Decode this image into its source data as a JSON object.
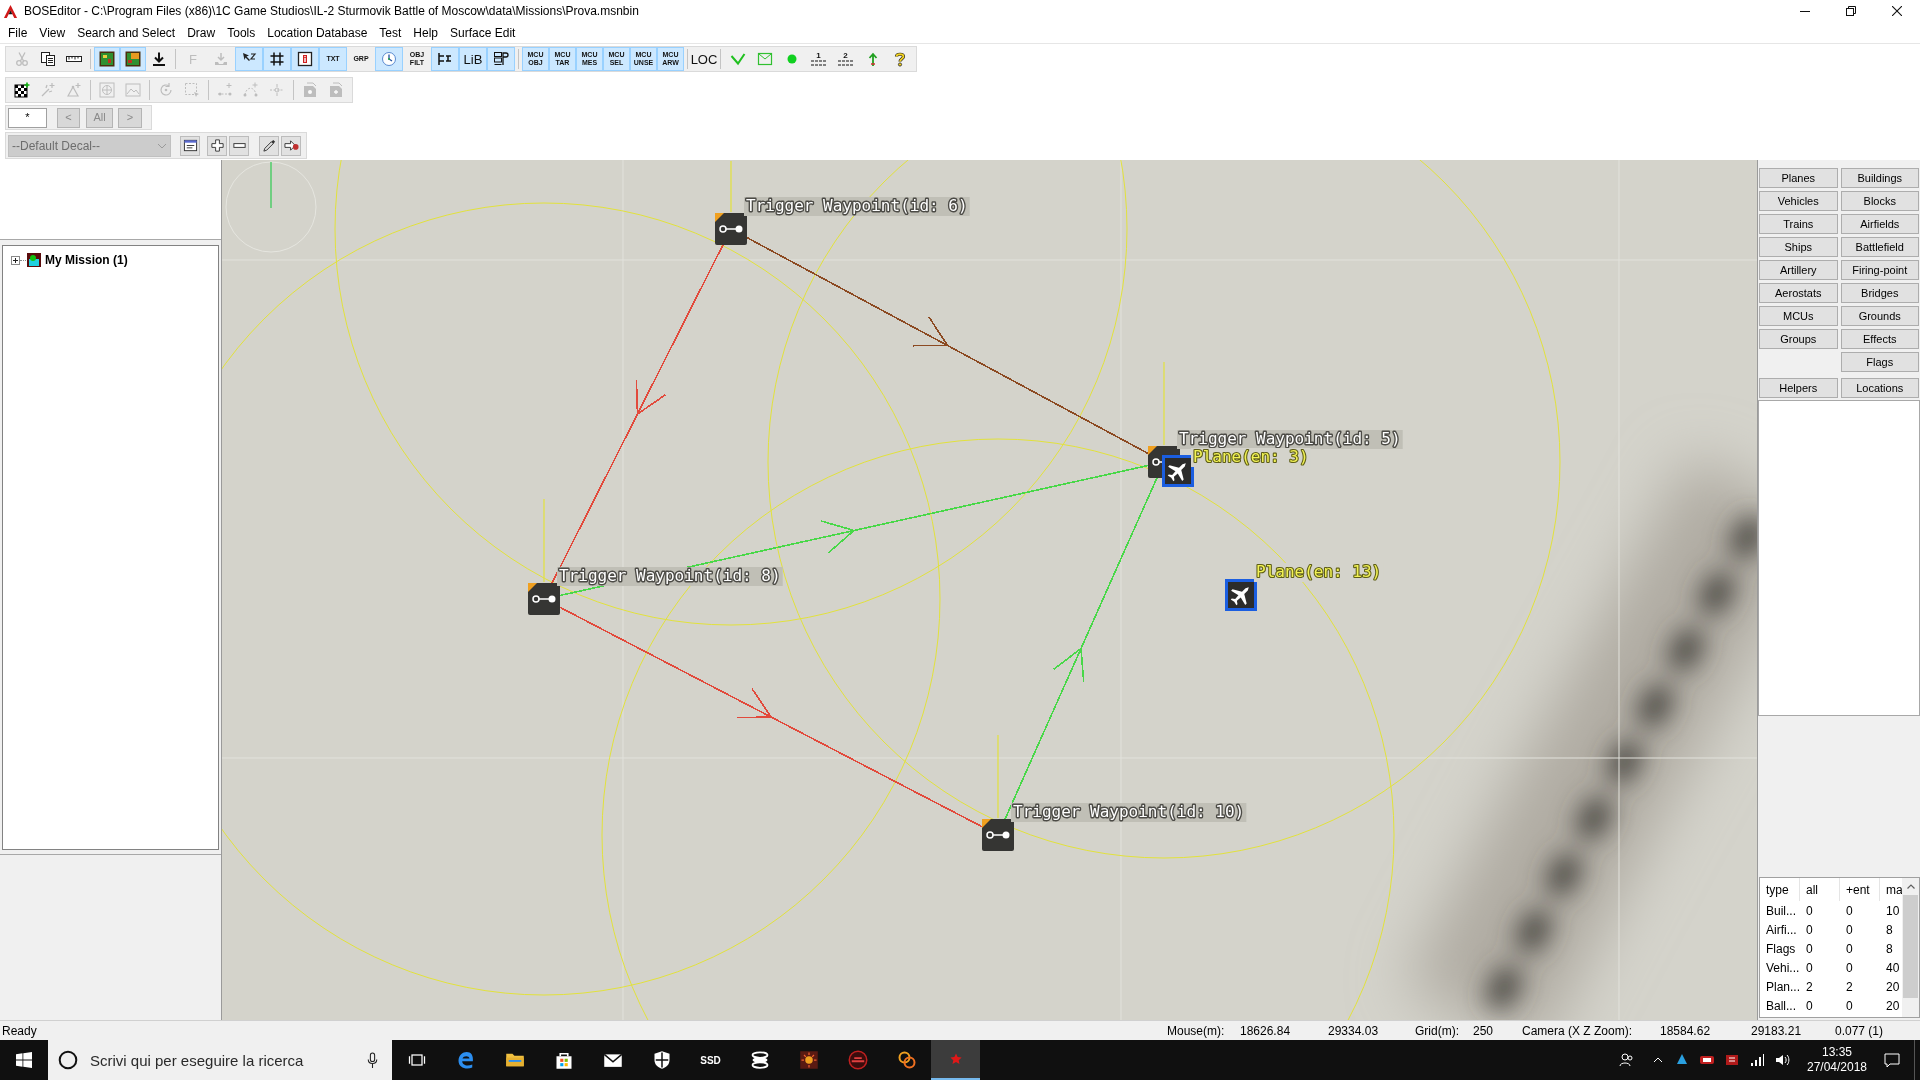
{
  "window": {
    "title": "BOSEditor - C:\\Program Files (x86)\\1C Game Studios\\IL-2 Sturmovik Battle of Moscow\\data\\Missions\\Prova.msnbin"
  },
  "menu": [
    "File",
    "View",
    "Search and Select",
    "Draw",
    "Tools",
    "Location Database",
    "Test",
    "Help",
    "Surface Edit"
  ],
  "toolbars": [
    {
      "groups": [
        [
          {
            "kind": "icon",
            "pressed": false,
            "disabled": true
          },
          {
            "kind": "icon",
            "pressed": false,
            "disabled": false
          },
          {
            "kind": "icon",
            "pressed": false,
            "disabled": false
          }
        ],
        [
          {
            "kind": "icon",
            "pressed": true,
            "disabled": false
          },
          {
            "kind": "icon",
            "pressed": true,
            "disabled": false
          },
          {
            "kind": "icon",
            "pressed": false,
            "disabled": false
          }
        ],
        [
          {
            "kind": "glyph",
            "label": "F",
            "pressed": false,
            "disabled": true
          },
          {
            "kind": "icon",
            "pressed": false,
            "disabled": true
          },
          {
            "kind": "icon",
            "pressed": true,
            "disabled": false
          },
          {
            "kind": "icon",
            "pressed": true,
            "disabled": false
          },
          {
            "kind": "icon",
            "pressed": true,
            "disabled": false
          },
          {
            "kind": "tag",
            "label": "TXT",
            "pressed": true,
            "disabled": false
          },
          {
            "kind": "tag",
            "label": "GRP",
            "pressed": false,
            "disabled": false
          },
          {
            "kind": "icon",
            "pressed": true,
            "disabled": false
          },
          {
            "kind": "tag",
            "label": "OBJ FILT",
            "pressed": false,
            "disabled": false
          },
          {
            "kind": "icon",
            "pressed": true,
            "disabled": false
          },
          {
            "kind": "glyph",
            "label": "LiB",
            "pressed": true,
            "disabled": false
          },
          {
            "kind": "icon",
            "pressed": true,
            "disabled": false
          }
        ],
        [
          {
            "kind": "tag",
            "label": "MCU OBJ",
            "pressed": true,
            "disabled": false
          },
          {
            "kind": "tag",
            "label": "MCU TAR",
            "pressed": true,
            "disabled": false
          },
          {
            "kind": "tag",
            "label": "MCU MES",
            "pressed": true,
            "disabled": false
          },
          {
            "kind": "tag",
            "label": "MCU SEL",
            "pressed": true,
            "disabled": false
          },
          {
            "kind": "tag",
            "label": "MCU UNSE",
            "pressed": true,
            "disabled": false
          },
          {
            "kind": "tag",
            "label": "MCU ARW",
            "pressed": true,
            "disabled": false
          }
        ],
        [
          {
            "kind": "glyph",
            "label": "LOC",
            "pressed": false,
            "disabled": false
          }
        ],
        [
          {
            "kind": "icon",
            "pressed": false,
            "disabled": false
          },
          {
            "kind": "icon",
            "pressed": false,
            "disabled": false
          },
          {
            "kind": "icon",
            "pressed": false,
            "disabled": false
          },
          {
            "kind": "layer",
            "label": "1",
            "pressed": false,
            "disabled": false
          },
          {
            "kind": "layer",
            "label": "2",
            "pressed": false,
            "disabled": false
          },
          {
            "kind": "icon",
            "pressed": false,
            "disabled": false
          },
          {
            "kind": "icon",
            "pressed": false,
            "disabled": false
          }
        ]
      ]
    },
    {
      "groups": [
        [
          {
            "kind": "icon",
            "disabled": false
          },
          {
            "kind": "icon",
            "disabled": true
          },
          {
            "kind": "icon",
            "disabled": true
          }
        ],
        [
          {
            "kind": "icon",
            "disabled": true
          },
          {
            "kind": "icon",
            "disabled": true
          }
        ],
        [
          {
            "kind": "icon",
            "disabled": true
          },
          {
            "kind": "icon",
            "disabled": true
          }
        ],
        [
          {
            "kind": "icon",
            "disabled": true
          },
          {
            "kind": "icon",
            "disabled": true
          },
          {
            "kind": "icon",
            "disabled": true
          }
        ],
        [
          {
            "kind": "icon",
            "disabled": true
          },
          {
            "kind": "icon",
            "disabled": true
          }
        ]
      ]
    }
  ],
  "filter_buttons": [
    {
      "label": "*",
      "disabled": false
    },
    {
      "label": "<",
      "disabled": true
    },
    {
      "label": "All",
      "disabled": true
    },
    {
      "label": ">",
      "disabled": true
    }
  ],
  "decal": {
    "value": "--Default Decal--",
    "disabled": true
  },
  "tree": [
    {
      "label": "My Mission (1)",
      "expanded": false
    }
  ],
  "map": {
    "nodes": [
      {
        "kind": "waypoint",
        "label": "Trigger Waypoint(id: 6)"
      },
      {
        "kind": "waypoint",
        "label": "Trigger Waypoint(id: 5)"
      },
      {
        "kind": "plane",
        "label": "Plane(en: 3)"
      },
      {
        "kind": "waypoint",
        "label": "Trigger Waypoint(id: 8)"
      },
      {
        "kind": "plane",
        "label": "Plane(en: 13)"
      },
      {
        "kind": "waypoint",
        "label": "Trigger Waypoint(id: 10)"
      }
    ],
    "links": [
      {
        "color": "#8c4a22"
      },
      {
        "color": "#e24a3c"
      },
      {
        "color": "#e24a3c"
      },
      {
        "color": "#48d848"
      },
      {
        "color": "#48d848"
      }
    ]
  },
  "object_buttons": [
    {
      "left": "Planes",
      "right": "Buildings"
    },
    {
      "left": "Vehicles",
      "right": "Blocks"
    },
    {
      "left": "Trains",
      "right": "Airfields"
    },
    {
      "left": "Ships",
      "right": "Battlefield"
    },
    {
      "left": "Artillery",
      "right": "Firing-point"
    },
    {
      "left": "Aerostats",
      "right": "Bridges"
    },
    {
      "left": "MCUs",
      "right": "Grounds"
    },
    {
      "left": "Groups",
      "right": "Effects"
    },
    {
      "right": "Flags"
    }
  ],
  "panel_buttons": [
    "Helpers",
    "Locations"
  ],
  "limits_table": {
    "columns": [
      "type",
      "all",
      "+ent",
      "ma"
    ],
    "rows": [
      [
        "Buil...",
        "0",
        "0",
        "10"
      ],
      [
        "Airfi...",
        "0",
        "0",
        "8"
      ],
      [
        "Flags",
        "0",
        "0",
        "8"
      ],
      [
        "Vehi...",
        "0",
        "0",
        "40"
      ],
      [
        "Plan...",
        "2",
        "2",
        "20"
      ],
      [
        "Ball...",
        "0",
        "0",
        "20"
      ]
    ]
  },
  "status_bar": {
    "message": "Ready",
    "fields": [
      {
        "label": "Mouse(m):",
        "values": [
          "18626.84",
          "29334.03"
        ]
      },
      {
        "label": "Grid(m):",
        "values": [
          "250"
        ]
      },
      {
        "label": "Camera (X Z Zoom):",
        "values": [
          "18584.62",
          "29183.21",
          "0.077 (1)"
        ]
      }
    ]
  },
  "taskbar": {
    "search": {
      "placeholder": "Scrivi qui per eseguire la ricerca"
    },
    "apps": [
      {
        "kind": "icon",
        "selected": false
      },
      {
        "kind": "icon",
        "selected": false
      },
      {
        "kind": "icon",
        "selected": false
      },
      {
        "kind": "icon",
        "selected": false
      },
      {
        "kind": "icon",
        "selected": false
      },
      {
        "kind": "icon",
        "selected": false
      },
      {
        "kind": "text",
        "label": "SSD",
        "selected": false
      },
      {
        "kind": "icon",
        "selected": false
      },
      {
        "kind": "icon",
        "selected": false
      },
      {
        "kind": "icon",
        "selected": false
      },
      {
        "kind": "icon",
        "selected": false
      },
      {
        "kind": "icon",
        "selected": true
      }
    ],
    "clock": {
      "time": "13:35",
      "date": "27/04/2018"
    }
  }
}
